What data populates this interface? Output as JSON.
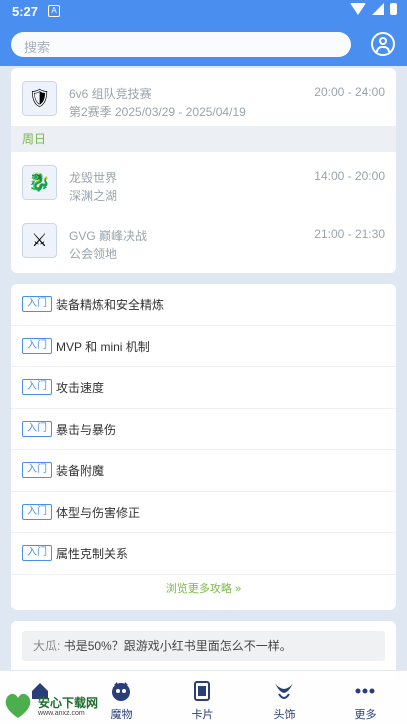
{
  "status_bar": {
    "time": "5:27",
    "notification_icon": "A"
  },
  "search": {
    "placeholder": "搜索"
  },
  "events": [
    {
      "title": "6v6 组队竞技赛",
      "subtitle": "第2赛季 2025/03/29 - 2025/04/19",
      "time": "20:00 - 24:00",
      "icon": "shield-badge"
    },
    {
      "day": "周日"
    },
    {
      "title": "龙毁世界",
      "subtitle": "深渊之湖",
      "time": "14:00 - 20:00",
      "icon": "dragon"
    },
    {
      "title": "GVG 巅峰决战",
      "subtitle": "公会领地",
      "time": "21:00 - 21:30",
      "icon": "crossed-swords"
    }
  ],
  "guides": [
    {
      "tag": "入门",
      "label": "装备精炼和安全精炼"
    },
    {
      "tag": "入门",
      "label": "MVP 和 mini 机制"
    },
    {
      "tag": "入门",
      "label": "攻击速度"
    },
    {
      "tag": "入门",
      "label": "暴击与暴伤"
    },
    {
      "tag": "入门",
      "label": "装备附魔"
    },
    {
      "tag": "入门",
      "label": "体型与伤害修正"
    },
    {
      "tag": "入门",
      "label": "属性克制关系"
    }
  ],
  "more_guides": "浏览更多攻略 »",
  "comment": {
    "author": "大瓜:",
    "text": "书是50%？跟游戏小红书里面怎么不一样。"
  },
  "tabs": [
    {
      "label": "",
      "icon": "home-icon"
    },
    {
      "label": "魔物",
      "icon": "monster-icon"
    },
    {
      "label": "卡片",
      "icon": "card-icon"
    },
    {
      "label": "头饰",
      "icon": "headgear-icon"
    },
    {
      "label": "更多",
      "icon": "more-icon"
    }
  ],
  "watermark": {
    "name": "安心下载网",
    "url": "www.anxz.com"
  },
  "colors": {
    "primary": "#4a8ef0",
    "accent_green": "#7ab84b"
  }
}
